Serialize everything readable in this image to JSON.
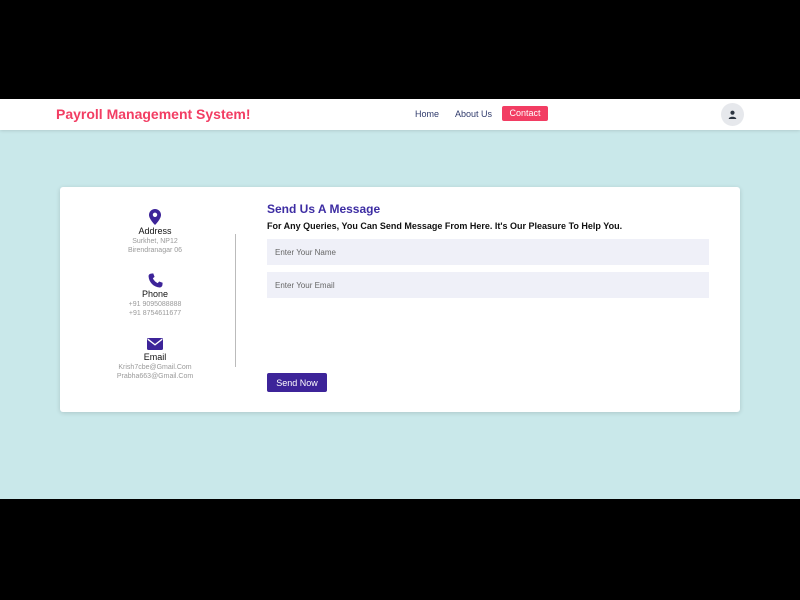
{
  "navbar": {
    "brand": "Payroll Management System!",
    "links": {
      "home": "Home",
      "about": "About Us",
      "contact": "Contact"
    },
    "accent_color": "#f23d63"
  },
  "contact_info": {
    "address": {
      "title": "Address",
      "lines": [
        "Surkhet, NP12",
        "Birendranagar 06"
      ],
      "icon": "map-pin-icon"
    },
    "phone": {
      "title": "Phone",
      "lines": [
        "+91 9095088888",
        "+91 8754611677"
      ],
      "icon": "phone-icon"
    },
    "email": {
      "title": "Email",
      "lines": [
        "Krish7cbe@Gmail.Com",
        "Prabha663@Gmail.Com"
      ],
      "icon": "envelope-icon"
    }
  },
  "form": {
    "title": "Send Us A Message",
    "subtitle": "For Any Queries, You Can Send Message From Here. It's Our Pleasure To Help You.",
    "name_placeholder": "Enter Your Name",
    "email_placeholder": "Enter Your Email",
    "submit_label": "Send Now",
    "accent_color": "#3d2da3"
  },
  "colors": {
    "background": "#c9e8ea",
    "field_bg": "#eff0f8"
  }
}
